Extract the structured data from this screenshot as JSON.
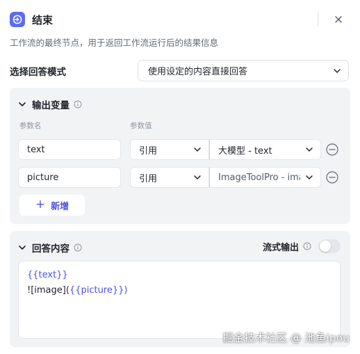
{
  "header": {
    "title": "结束",
    "icon": "end-node-icon",
    "close_icon": "close-icon"
  },
  "description": "工作流的最终节点，用于返回工作流运行后的结果信息",
  "answer_mode": {
    "label": "选择回答模式",
    "selected": "使用设定的内容直接回答"
  },
  "output_vars": {
    "title": "输出变量",
    "col_name": "参数名",
    "col_value": "参数值",
    "rows": [
      {
        "name": "text",
        "type": "引用",
        "value": "大模型 - text",
        "value_muted": false
      },
      {
        "name": "picture",
        "type": "引用",
        "value": "ImageToolPro - image_url",
        "value_muted": true
      }
    ],
    "add_label": "新增"
  },
  "answer_content": {
    "title": "回答内容",
    "stream_label": "流式输出",
    "stream_enabled": false,
    "line1": "{{text}}",
    "line2_prefix": "![image](",
    "line2_ref": "{{picture}}",
    "line2_suffix": ")"
  },
  "watermark": "掘金技术社区 @ 池鱼ipou",
  "colors": {
    "accent": "#4d53e8",
    "icon_bg": "#5b6cf0",
    "panel_bg": "#f2f3f5"
  }
}
